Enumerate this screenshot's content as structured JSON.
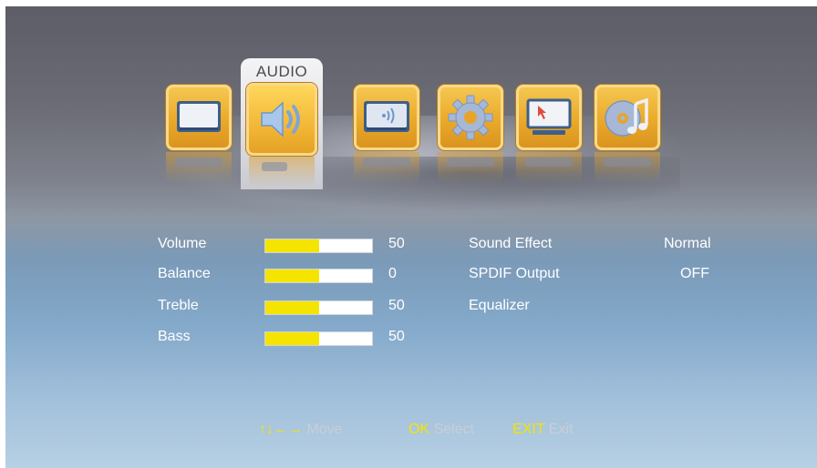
{
  "menu": {
    "active_tab_label": "AUDIO",
    "tabs": [
      {
        "name": "picture",
        "icon": "tv-screen-icon"
      },
      {
        "name": "audio",
        "icon": "speaker-icon"
      },
      {
        "name": "channel",
        "icon": "broadcast-tv-icon"
      },
      {
        "name": "setup",
        "icon": "gear-icon"
      },
      {
        "name": "pc",
        "icon": "monitor-cursor-icon"
      },
      {
        "name": "media",
        "icon": "music-disc-icon"
      }
    ]
  },
  "settings_left": [
    {
      "label": "Volume",
      "value": "50",
      "level": 0.5
    },
    {
      "label": "Balance",
      "value": "0",
      "level": 0.5
    },
    {
      "label": "Treble",
      "value": "50",
      "level": 0.5
    },
    {
      "label": "Bass",
      "value": "50",
      "level": 0.5
    }
  ],
  "settings_right": [
    {
      "label": "Sound Effect",
      "value": "Normal"
    },
    {
      "label": "SPDIF Output",
      "value": "OFF"
    },
    {
      "label": "Equalizer",
      "value": ""
    }
  ],
  "footer": {
    "move_keys": "↑↓←→",
    "move_label": "Move",
    "ok_key": "OK",
    "ok_label": "Select",
    "exit_key": "EXIT",
    "exit_label": "Exit"
  },
  "colors": {
    "slider_fill": "#f5e400",
    "key_highlight": "#f4e400",
    "tile": "#eaa92a"
  }
}
